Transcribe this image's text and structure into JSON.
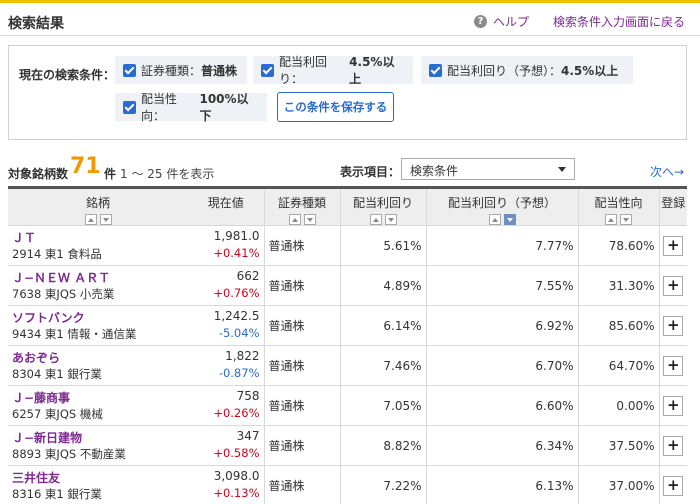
{
  "header": {
    "title": "検索結果",
    "help_label": "ヘルプ",
    "help_icon": "question-circle-icon",
    "back_link": "検索条件入力画面に戻る"
  },
  "conditions": {
    "label": "現在の検索条件：",
    "chips": [
      {
        "name": "証券種類：",
        "value": "普通株"
      },
      {
        "name": "配当利回り：",
        "value": "4.5%以上"
      },
      {
        "name": "配当利回り（予想）：",
        "value": "4.5%以上"
      },
      {
        "name": "配当性向：",
        "value": "100%以下"
      }
    ],
    "save_button": "この条件を保存する"
  },
  "summary": {
    "count_label": "対象銘柄数",
    "count": "71",
    "count_unit": "件",
    "range": "1 ～ 25 件を表示",
    "display_label": "表示項目：",
    "display_value": "検索条件",
    "next_link": "次へ→"
  },
  "table": {
    "headers": {
      "name": "銘柄",
      "price": "現在値",
      "type": "証券種類",
      "yield": "配当利回り",
      "yield_forecast": "配当利回り（予想）",
      "payout": "配当性向",
      "register": "登録"
    },
    "rows": [
      {
        "name": "ＪＴ",
        "info": "2914 東1 食料品",
        "price": "1,981.0",
        "change": "+0.41%",
        "dir": "up",
        "type": "普通株",
        "yield": "5.61%",
        "yield_forecast": "7.77%",
        "payout": "78.60%"
      },
      {
        "name": "Ｊ−ＮＥＷ ＡＲＴ",
        "info": "7638 東JQS 小売業",
        "price": "662",
        "change": "+0.76%",
        "dir": "up",
        "type": "普通株",
        "yield": "4.89%",
        "yield_forecast": "7.55%",
        "payout": "31.30%"
      },
      {
        "name": "ソフトバンク",
        "info": "9434 東1 情報・通信業",
        "price": "1,242.5",
        "change": "-5.04%",
        "dir": "down",
        "type": "普通株",
        "yield": "6.14%",
        "yield_forecast": "6.92%",
        "payout": "85.60%"
      },
      {
        "name": "あおぞら",
        "info": "8304 東1 銀行業",
        "price": "1,822",
        "change": "-0.87%",
        "dir": "down",
        "type": "普通株",
        "yield": "7.46%",
        "yield_forecast": "6.70%",
        "payout": "64.70%"
      },
      {
        "name": "Ｊ−藤商事",
        "info": "6257 東JQS 機械",
        "price": "758",
        "change": "+0.26%",
        "dir": "up",
        "type": "普通株",
        "yield": "7.05%",
        "yield_forecast": "6.60%",
        "payout": "0.00%"
      },
      {
        "name": "Ｊ−新日建物",
        "info": "8893 東JQS 不動産業",
        "price": "347",
        "change": "+0.58%",
        "dir": "up",
        "type": "普通株",
        "yield": "8.82%",
        "yield_forecast": "6.34%",
        "payout": "37.50%"
      },
      {
        "name": "三井住友",
        "info": "8316 東1 銀行業",
        "price": "3,098.0",
        "change": "+0.13%",
        "dir": "up",
        "type": "普通株",
        "yield": "7.22%",
        "yield_forecast": "6.13%",
        "payout": "37.00%"
      }
    ],
    "add_label": "+"
  },
  "colors": {
    "accent_yellow": "#f2c200",
    "link_purple": "#7c2a90",
    "link_blue": "#2a6bd3",
    "count_orange": "#f09a00",
    "up_red": "#d0021b",
    "down_blue": "#2a6bd3"
  }
}
